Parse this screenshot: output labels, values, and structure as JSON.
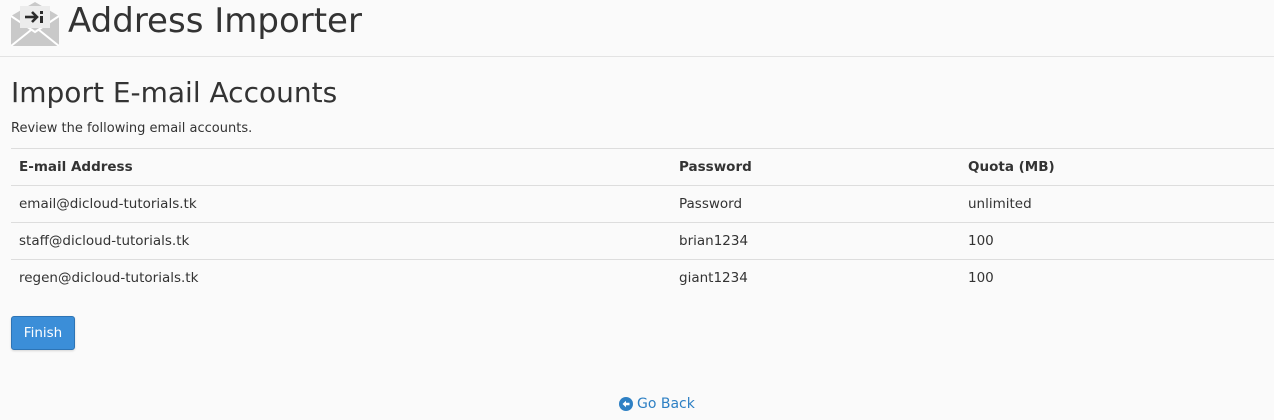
{
  "header": {
    "title": "Address Importer",
    "icon": "envelope-import-icon"
  },
  "section": {
    "title": "Import E-mail Accounts",
    "description": "Review the following email accounts."
  },
  "table": {
    "columns": [
      "E-mail Address",
      "Password",
      "Quota (MB)"
    ],
    "rows": [
      {
        "email": "email@dicloud-tutorials.tk",
        "password": "Password",
        "quota": "unlimited"
      },
      {
        "email": "staff@dicloud-tutorials.tk",
        "password": "brian1234",
        "quota": "100"
      },
      {
        "email": "regen@dicloud-tutorials.tk",
        "password": "giant1234",
        "quota": "100"
      }
    ]
  },
  "actions": {
    "finish_label": "Finish",
    "go_back_label": "Go Back",
    "go_back_icon": "circle-arrow-left-icon"
  },
  "colors": {
    "primary_button": "#3b8ed8",
    "link": "#2e80c4",
    "background": "#fafafa"
  }
}
